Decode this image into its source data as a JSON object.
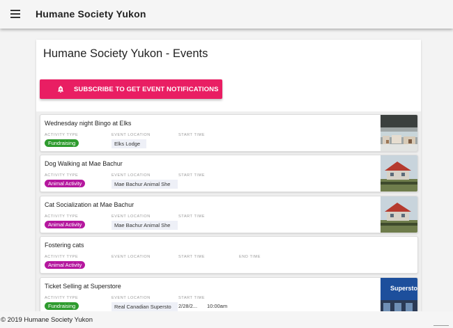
{
  "app_bar": {
    "title": "Humane Society Yukon",
    "menu_icon": "hamburger-menu-icon"
  },
  "page": {
    "title": "Humane Society Yukon - Events"
  },
  "subscribe_button": {
    "label": "SUBSCRIBE TO GET EVENT NOTIFICATIONS",
    "icon": "bell-icon",
    "color": "#e91e63"
  },
  "labels": {
    "activity_type": "ACTIVITY TYPE",
    "event_location": "EVENT LOCATION",
    "start_time": "START TIME",
    "end_time": "END TIME"
  },
  "colors": {
    "fundraising": "#2e9b2e",
    "animal_activity": "#b5179e",
    "accent": "#e91e63"
  },
  "events": [
    {
      "name": "Wednesday night Bingo at Elks",
      "activity": "Fundraising",
      "location": "Elks Lodge",
      "start_date": "",
      "start_time": ""
    },
    {
      "name": "Dog Walking at Mae Bachur",
      "activity": "Animal Activity",
      "location": "Mae Bachur Animal She",
      "start_date": "",
      "start_time": ""
    },
    {
      "name": "Cat Socialization at Mae Bachur",
      "activity": "Animal Activity",
      "location": "Mae Bachur Animal She",
      "start_date": "",
      "start_time": ""
    },
    {
      "name": "Fostering cats",
      "activity": "Animal Activity",
      "location": "",
      "start_date": "",
      "start_time": ""
    },
    {
      "name": "Ticket Selling at Superstore",
      "activity": "Fundraising",
      "location": "Real Canadian Supersto",
      "start_date": "2/28/2...",
      "start_time": "10:00am",
      "thumb_text": "Superstore"
    }
  ],
  "footer": {
    "text": "© 2019 Humane Society Yukon"
  }
}
